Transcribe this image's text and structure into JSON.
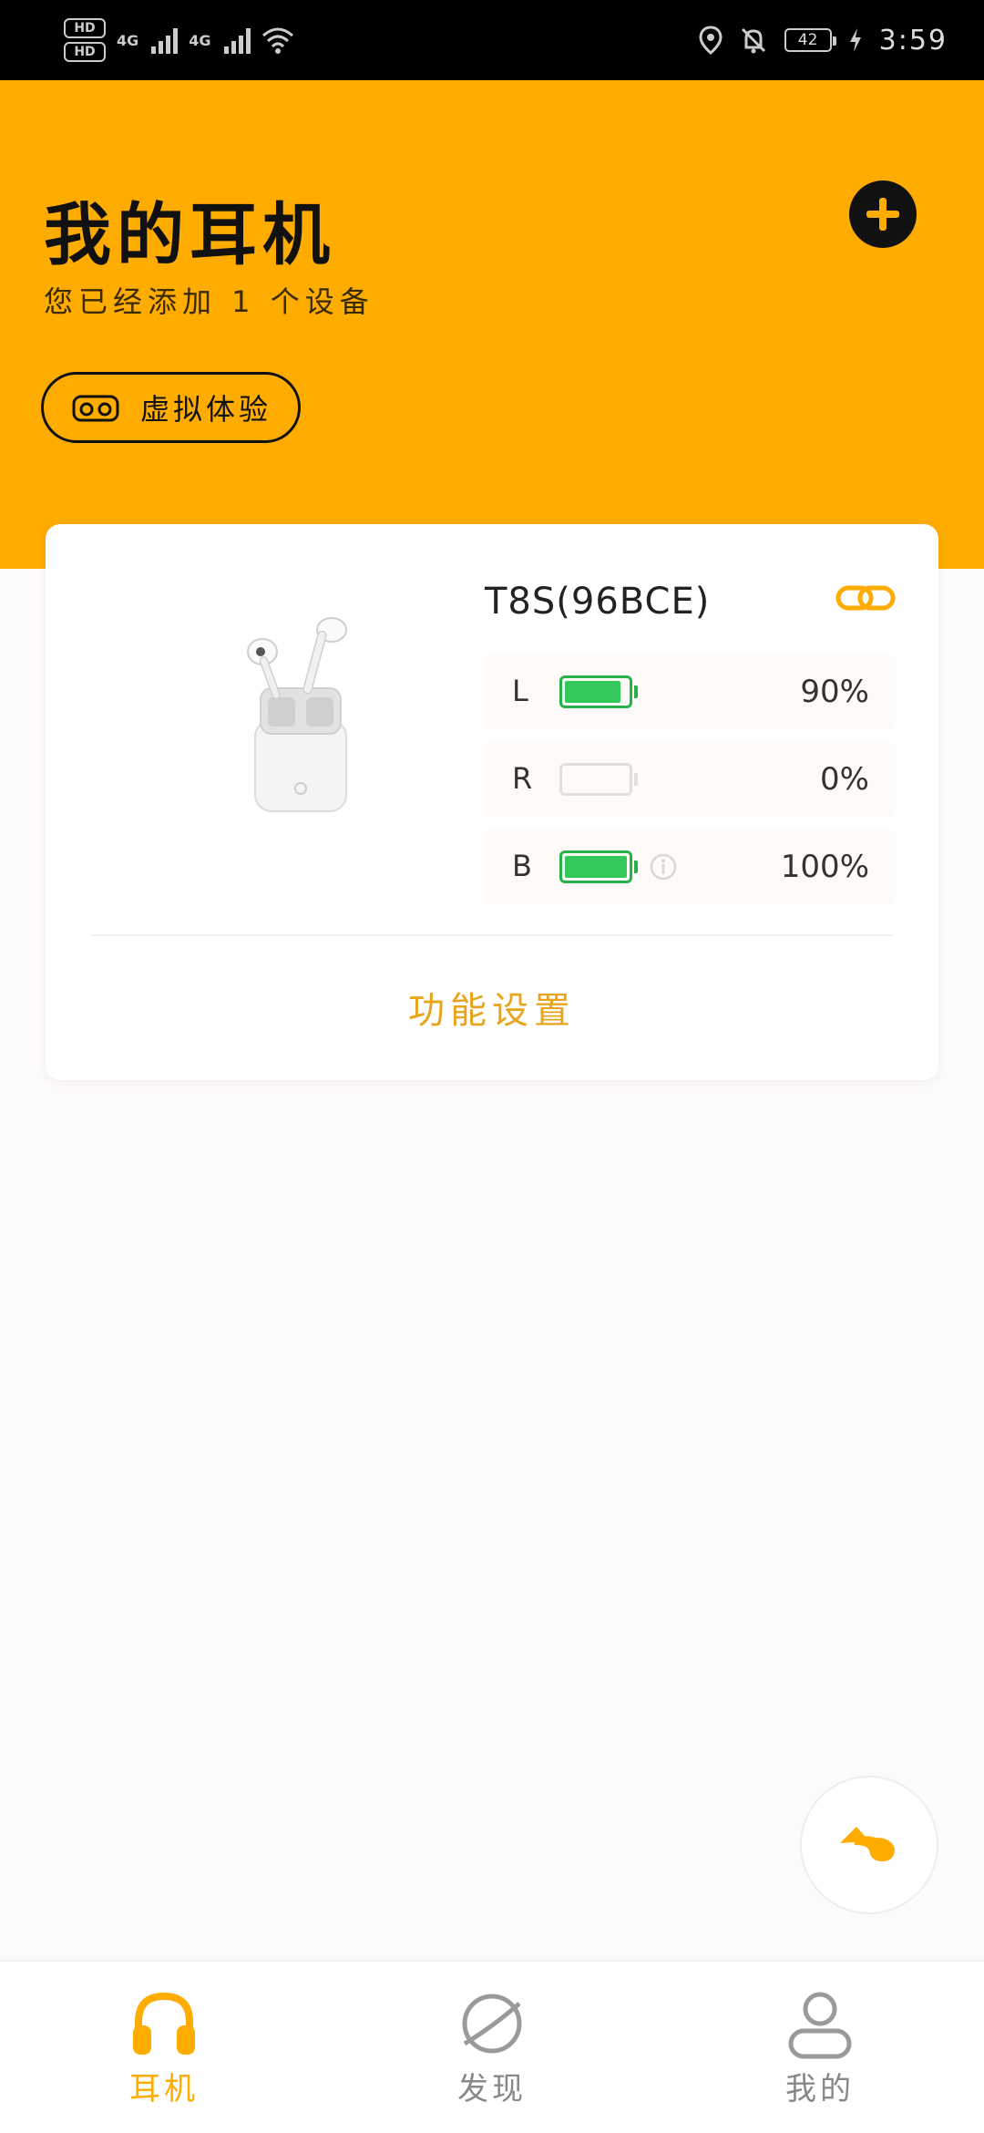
{
  "status_bar": {
    "hd1": "HD",
    "hd2": "HD",
    "net1": "4G",
    "net2": "4G",
    "battery": "42",
    "time": "3:59"
  },
  "header": {
    "title": "我的耳机",
    "subtitle": "您已经添加 1 个设备",
    "vr_button_label": "虚拟体验"
  },
  "device": {
    "name": "T8S(96BCE)",
    "rows": [
      {
        "label": "L",
        "value": "90%",
        "level": 0.9
      },
      {
        "label": "R",
        "value": "0%",
        "level": 0
      },
      {
        "label": "B",
        "value": "100%",
        "level": 1.0
      }
    ],
    "settings_label": "功能设置"
  },
  "nav": {
    "items": [
      {
        "label": "耳机",
        "icon": "headphones-icon",
        "active": true
      },
      {
        "label": "发现",
        "icon": "planet-icon",
        "active": false
      },
      {
        "label": "我的",
        "icon": "user-icon",
        "active": false
      }
    ]
  },
  "colors": {
    "accent": "#ffac00",
    "battery_green": "#34c759",
    "settings_text": "#e8a51c"
  }
}
